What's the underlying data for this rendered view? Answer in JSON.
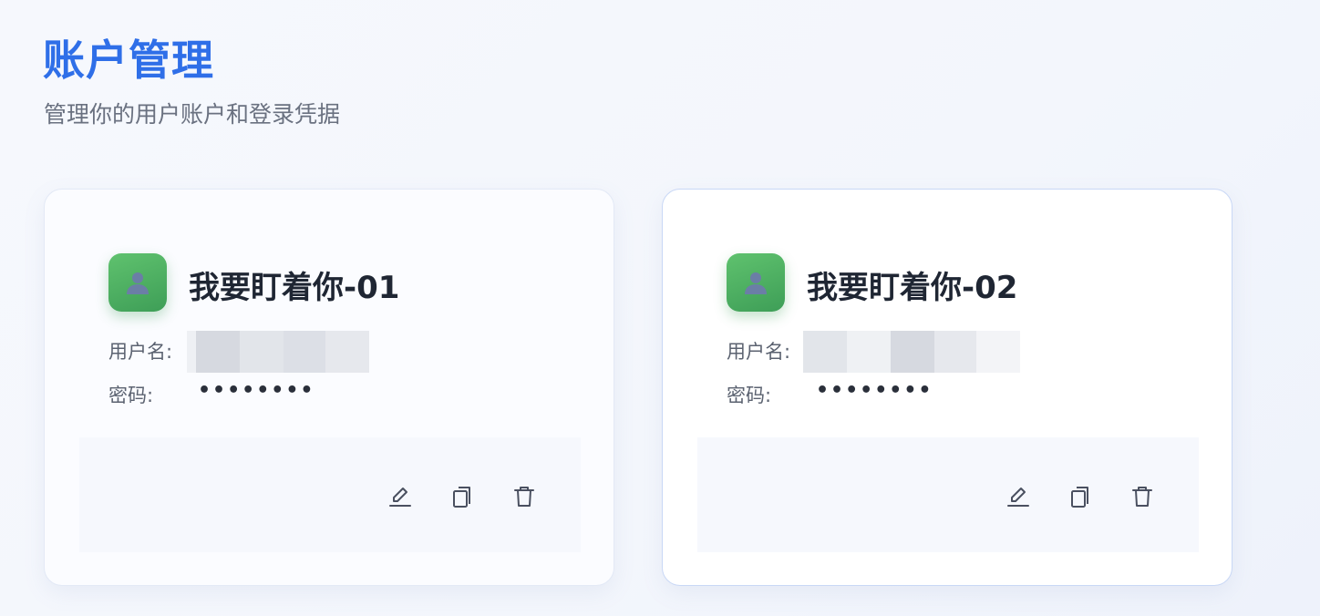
{
  "header": {
    "title": "账户管理",
    "subtitle": "管理你的用户账户和登录凭据"
  },
  "accounts": [
    {
      "name": "我要盯着你-01",
      "username_label": "用户名:",
      "password_label": "密码:",
      "password": "••••••••",
      "avatar_icon": "user-icon",
      "actions": [
        "edit-icon",
        "copy-icon",
        "trash-icon"
      ]
    },
    {
      "name": "我要盯着你-02",
      "username_label": "用户名:",
      "password_label": "密码:",
      "password": "••••••••",
      "avatar_icon": "user-icon",
      "actions": [
        "edit-icon",
        "copy-icon",
        "trash-icon"
      ]
    }
  ],
  "colors": {
    "accent": "#2f6fe8",
    "avatar": "#4caf62"
  }
}
